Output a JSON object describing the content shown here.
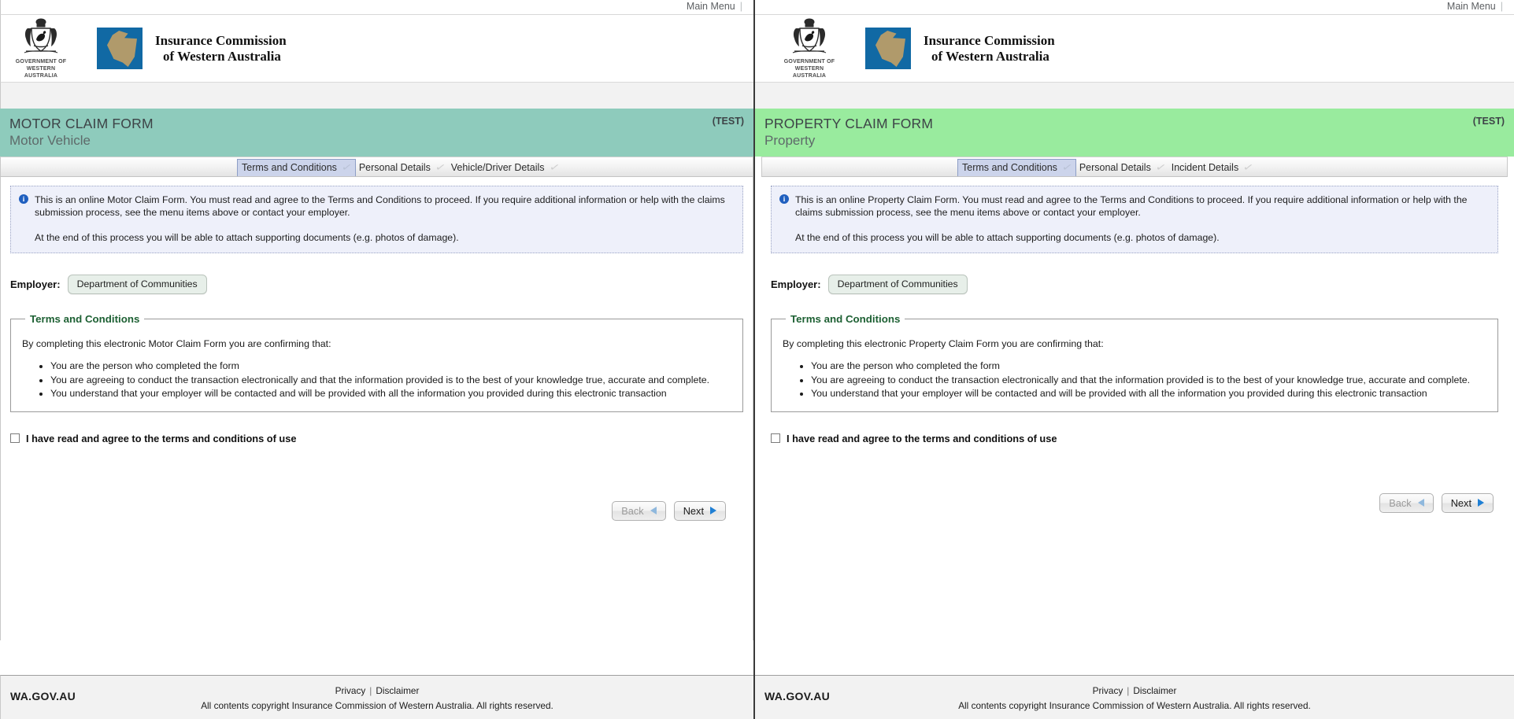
{
  "brand": {
    "crest_line1": "GOVERNMENT OF",
    "crest_line2": "WESTERN AUSTRALIA",
    "org_line1": "Insurance Commission",
    "org_line2": "of Western Australia",
    "logo_blue": "#1169a4",
    "logo_tan": "#b09a6b"
  },
  "topbar": {
    "main_menu": "Main Menu",
    "separator": "|"
  },
  "left_panel": {
    "banner": {
      "title": "MOTOR CLAIM FORM",
      "subtitle": "Motor Vehicle",
      "test_tag": "(TEST)",
      "color": "#8ecbbc"
    },
    "tabs": [
      {
        "label": "Terms and Conditions",
        "active": true,
        "tick": "✓"
      },
      {
        "label": "Personal Details",
        "active": false,
        "tick": "✓"
      },
      {
        "label": "Vehicle/Driver Details",
        "active": false,
        "tick": "✓"
      }
    ],
    "notice": {
      "paragraph1": "This is an online Motor Claim Form. You must read and agree to the Terms and Conditions to proceed. If you require additional information or help with the claims submission process, see the menu items above or contact your employer.",
      "paragraph2": "At the end of this process you will be able to attach supporting documents (e.g. photos of damage)."
    },
    "employer": {
      "label": "Employer:",
      "value": "Department of Communities"
    },
    "terms": {
      "legend": "Terms and Conditions",
      "intro": "By completing this electronic Motor Claim Form you are confirming that:",
      "items": [
        "You are the person who completed the form",
        "You are agreeing to conduct the transaction electronically and that the information provided is to the best of your knowledge true, accurate and complete.",
        "You understand that your employer will be contacted and will be provided with all the information you provided during this electronic transaction"
      ]
    },
    "agree": {
      "label": "I have read and agree to the terms and conditions of use",
      "checked": false
    },
    "buttons": {
      "back": "Back",
      "next": "Next",
      "back_disabled": true
    }
  },
  "right_panel": {
    "banner": {
      "title": "PROPERTY CLAIM FORM",
      "subtitle": "Property",
      "test_tag": "(TEST)",
      "color": "#99eb9e"
    },
    "tabs": [
      {
        "label": "Terms and Conditions",
        "active": true,
        "tick": "✓"
      },
      {
        "label": "Personal Details",
        "active": false,
        "tick": "✓"
      },
      {
        "label": "Incident Details",
        "active": false,
        "tick": "✓"
      }
    ],
    "notice": {
      "paragraph1": "This is an online Property Claim Form. You must read and agree to the Terms and Conditions to proceed. If you require additional information or help with the claims submission process, see the menu items above or contact your employer.",
      "paragraph2": "At the end of this process you will be able to attach supporting documents (e.g. photos of damage)."
    },
    "employer": {
      "label": "Employer:",
      "value": "Department of Communities"
    },
    "terms": {
      "legend": "Terms and Conditions",
      "intro": "By completing this electronic Property Claim Form you are confirming that:",
      "items": [
        "You are the person who completed the form",
        "You are agreeing to conduct the transaction electronically and that the information provided is to the best of your knowledge true, accurate and complete.",
        "You understand that your employer will be contacted and will be provided with all the information you provided during this electronic transaction"
      ]
    },
    "agree": {
      "label": "I have read and agree to the terms and conditions of use",
      "checked": false
    },
    "buttons": {
      "back": "Back",
      "next": "Next",
      "back_disabled": true
    }
  },
  "footer": {
    "wagov": "WA.GOV.AU",
    "privacy": "Privacy",
    "separator": "|",
    "disclaimer": "Disclaimer",
    "copyright": "All contents copyright Insurance Commission of Western Australia. All rights reserved."
  }
}
